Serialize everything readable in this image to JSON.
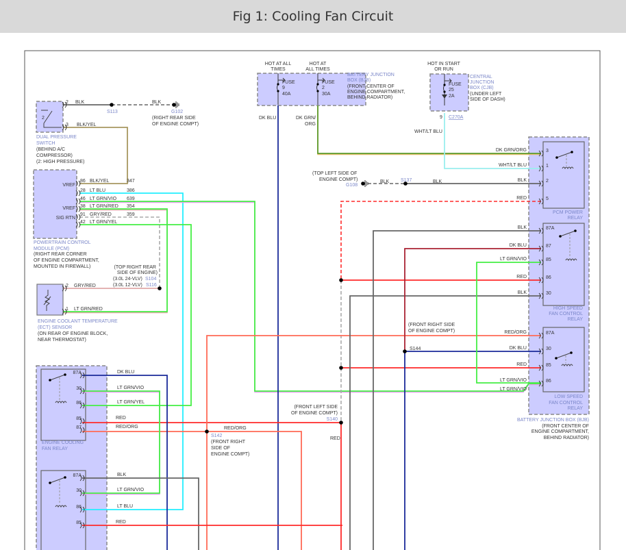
{
  "header": {
    "title": "Fig 1: Cooling Fan Circuit"
  },
  "dual_pressure_switch": {
    "name": [
      "DUAL PRESSURE",
      "SWITCH"
    ],
    "location": [
      "(BEHIND A/C",
      "COMPRESSOR)",
      "(2: HIGH PRESSURE)"
    ],
    "internal_label": "2",
    "pins": [
      {
        "pin": "2",
        "wire": "BLK"
      },
      {
        "pin": "3",
        "wire": "BLK/YEL"
      }
    ]
  },
  "ground_g102": {
    "splice": "S113",
    "wire": "BLK",
    "id": "G102",
    "location": [
      "(RIGHT REAR SIDE",
      "OF ENGINE COMPT)"
    ]
  },
  "pcm": {
    "name": [
      "POWERTRAIN CONTROL",
      "MODULE (PCM)"
    ],
    "location": [
      "(RIGHT REAR CORNER",
      "OF ENGINE COMPARTMENT,",
      "MOUNTED IN FIREWALL)"
    ],
    "terminals": [
      "VREF",
      "VREF",
      "SIG RTN"
    ],
    "pins": [
      {
        "pin": "86",
        "wire": "BLK/YEL",
        "circuit": "347"
      },
      {
        "pin": "28",
        "wire": "LT BLU",
        "circuit": "386"
      },
      {
        "pin": "46",
        "wire": "LT GRN/VIO",
        "circuit": "639"
      },
      {
        "pin": "38",
        "wire": "LT GRN/RED",
        "circuit": "354"
      },
      {
        "pin": "91",
        "wire": "GRY/RED",
        "circuit": "359"
      },
      {
        "pin": "42",
        "wire": "LT GRN/YEL",
        "circuit": ""
      }
    ]
  },
  "splice_s104": {
    "location": [
      "(TOP RIGHT REAR",
      "SIDE OF ENGINE)"
    ],
    "variants": [
      {
        "engine": "(3.0L 24-VLV)",
        "id": "S104"
      },
      {
        "engine": "(3.0L 12-VLV)",
        "id": "S116"
      }
    ]
  },
  "ect_sensor": {
    "name": [
      "ENGINE COOLANT TEMPERATURE",
      "(ECT) SENSOR"
    ],
    "location": [
      "(ON REAR OF ENGINE BLOCK,",
      "NEAR THERMOSTAT)"
    ],
    "pins": [
      {
        "pin": "2",
        "wire": "GRY/RED"
      },
      {
        "pin": "1",
        "wire": "LT GRN/RED"
      }
    ]
  },
  "bjb_fuses": {
    "feeds": [
      [
        "HOT AT ALL",
        "TIMES"
      ],
      [
        "HOT AT",
        "ALL TIMES"
      ]
    ],
    "fuses": [
      {
        "label": "FUSE",
        "number": "9",
        "rating": "40A",
        "wire": "DK BLU"
      },
      {
        "label": "FUSE",
        "number": "2",
        "rating": "30A",
        "wire": [
          "DK GRN/",
          "ORG"
        ]
      }
    ],
    "name": [
      "BATTERY JUNCTION",
      "BOX (BJB)"
    ],
    "location": [
      "(FRONT CENTER OF",
      "ENGINE COMPARTMENT,",
      "BEHIND RADIATOR)"
    ]
  },
  "cjb": {
    "feed": [
      "HOT IN START",
      "OR RUN"
    ],
    "fuse": {
      "label": "FUSE",
      "number": "25",
      "rating": "2A"
    },
    "name": [
      "CENTRAL",
      "JUNCTION",
      "BOX (CJB)"
    ],
    "location": [
      "(UNDER LEFT",
      "SIDE OF DASH)"
    ],
    "connector_pin": "9",
    "connector": "C270A",
    "wire": "WHT/LT BLU"
  },
  "ground_g108": {
    "location": [
      "(TOP LEFT SIDE OF",
      "ENGINE COMPT)"
    ],
    "id": "G108",
    "splice": "S137",
    "wires": [
      "BLK",
      "BLK"
    ]
  },
  "splice_s144": {
    "location": [
      "(FRONT RIGHT SIDE",
      "OF ENGINE COMPT)"
    ],
    "id": "S144"
  },
  "splice_s142": {
    "id": "S142",
    "location": [
      "(FRONT RIGHT",
      "SIDE OF",
      "ENGINE COMPT)"
    ],
    "wire": "RED/ORG"
  },
  "splice_s140": {
    "location": [
      "(FRONT LEFT SIDE",
      "OF ENGINE COMPT)"
    ],
    "id": "S140",
    "wire": "RED"
  },
  "bjb_relays": {
    "pcm_power_relay": {
      "name": [
        "PCM POWER",
        "RELAY"
      ],
      "pins": [
        {
          "pin": "3",
          "wire": "DK GRN/ORG"
        },
        {
          "pin": "1",
          "wire": "WHT/LT BLU"
        },
        {
          "pin": "2",
          "wire": "BLK"
        },
        {
          "pin": "5",
          "wire": "RED"
        }
      ]
    },
    "high_speed_relay": {
      "name": [
        "HIGH SPEED",
        "FAN CONTROL",
        "RELAY"
      ],
      "pins": [
        {
          "pin": "87A",
          "wire": "BLK"
        },
        {
          "pin": "87",
          "wire": "DK BLU"
        },
        {
          "pin": "85",
          "wire": "LT GRN/VIO"
        },
        {
          "pin": "86",
          "wire": "RED"
        },
        {
          "pin": "30",
          "wire": "BLK"
        }
      ]
    },
    "low_speed_relay": {
      "name": [
        "LOW SPEED",
        "FAN CONTROL",
        "RELAY"
      ],
      "pins": [
        {
          "pin": "87A",
          "wire": "RED/ORG"
        },
        {
          "pin": "30",
          "wire": "DK BLU"
        },
        {
          "pin": "85",
          "wire": "RED"
        },
        {
          "pin": "86",
          "wire": "LT GRN/VIO"
        }
      ],
      "extra_wire": "LT GRN/VIO"
    },
    "name": "BATTERY JUNCTION BOX (BJB)",
    "location": [
      "(FRONT CENTER OF",
      "ENGINE COMPARTMENT,",
      "BEHIND RADIATOR)"
    ]
  },
  "engine_cooling_fan_relay": {
    "name": [
      "ENGINE COOLING",
      "FAN RELAY"
    ],
    "pins": [
      {
        "pin": "87A",
        "wire": "DK BLU"
      },
      {
        "pin": "30",
        "wire": "LT GRN/VIO"
      },
      {
        "pin": "86",
        "wire": "LT GRN/YEL"
      },
      {
        "pin": "85",
        "wire": "RED"
      },
      {
        "pin": "87",
        "wire": "RED/ORG"
      }
    ]
  },
  "lower_relay": {
    "pins": [
      {
        "pin": "87A",
        "wire": "BLK"
      },
      {
        "pin": "30",
        "wire": "LT GRN/VIO"
      },
      {
        "pin": "86",
        "wire": "LT BLU"
      },
      {
        "pin": "85",
        "wire": "RED"
      }
    ]
  },
  "colors": {
    "box_fill": "#ccccff",
    "label_blue": "#7a86c8",
    "BLK": "#666666",
    "DK BLU": "#1a2a99",
    "LT BLU": "#22eeff",
    "LT GRN": "#44ee44",
    "VIO": "#e8a0f0",
    "RED": "#ff2a2a",
    "RED/ORG": "#ff6a55",
    "DK GRN/ORG": "#5a9a2a",
    "WHT/LT BLU": "#99eeee",
    "BLK/YEL": "#a89860",
    "GRY/RED": "#e0a8a8",
    "DK RED": "#aa2233",
    "GRY": "#aaaaaa"
  }
}
